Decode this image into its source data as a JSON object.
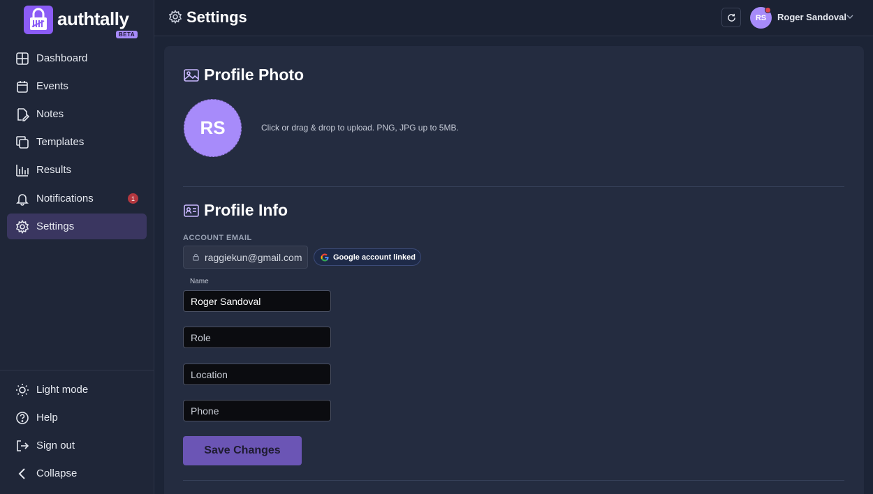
{
  "brand": {
    "name": "authtally",
    "badge": "BETA"
  },
  "sidebar": {
    "items": [
      {
        "label": "Dashboard",
        "icon": "dashboard-grid-icon"
      },
      {
        "label": "Events",
        "icon": "calendar-icon"
      },
      {
        "label": "Notes",
        "icon": "notes-pencil-icon"
      },
      {
        "label": "Templates",
        "icon": "templates-copy-icon"
      },
      {
        "label": "Results",
        "icon": "bar-chart-icon"
      },
      {
        "label": "Notifications",
        "icon": "bell-icon",
        "badge": "1"
      },
      {
        "label": "Settings",
        "icon": "gear-icon",
        "active": true
      }
    ],
    "bottom": [
      {
        "label": "Light mode",
        "icon": "sun-icon"
      },
      {
        "label": "Help",
        "icon": "help-circle-icon"
      },
      {
        "label": "Sign out",
        "icon": "sign-out-icon"
      },
      {
        "label": "Collapse",
        "icon": "chevron-left-icon"
      }
    ]
  },
  "topbar": {
    "title": "Settings",
    "user": {
      "initials": "RS",
      "name": "Roger Sandoval"
    }
  },
  "profile_photo": {
    "title": "Profile Photo",
    "initials": "RS",
    "hint": "Click or drag & drop to upload. PNG, JPG up to 5MB."
  },
  "profile_info": {
    "title": "Profile Info",
    "account_email_label": "ACCOUNT EMAIL",
    "email": "raggiekun@gmail.com",
    "google_badge": "Google account linked",
    "name_label": "Name",
    "name_value": "Roger Sandoval",
    "role_placeholder": "Role",
    "location_placeholder": "Location",
    "phone_placeholder": "Phone",
    "save_label": "Save Changes"
  },
  "colors": {
    "accent": "#8b5cf6",
    "avatar": "#a78bfa",
    "save_button": "#6b55b5",
    "badge_red": "#b3373f"
  }
}
